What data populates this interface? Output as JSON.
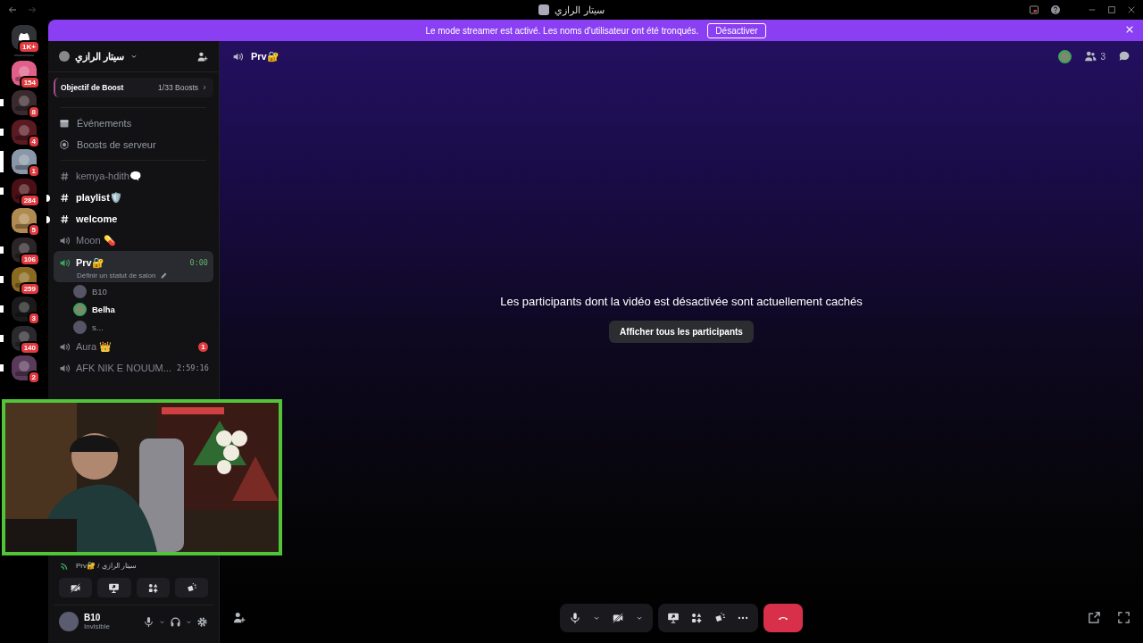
{
  "titlebar": {
    "title": "سيتار الرازي"
  },
  "banner": {
    "message": "Le mode streamer est activé. Les noms d'utilisateur ont été tronqués.",
    "button": "Désactiver"
  },
  "servers": [
    {
      "kind": "home",
      "badge": "1K+",
      "color": "#313338",
      "selected": false,
      "unread": false
    },
    {
      "kind": "server",
      "badge": "154",
      "color": "#e0608a",
      "selected": false,
      "unread": false
    },
    {
      "kind": "server",
      "badge": "8",
      "color": "#3a2a2e",
      "selected": false,
      "unread": true
    },
    {
      "kind": "server",
      "badge": "4",
      "color": "#5a1a22",
      "selected": false,
      "unread": true
    },
    {
      "kind": "server",
      "badge": "1",
      "color": "#8a97a8",
      "selected": true,
      "unread": false
    },
    {
      "kind": "server",
      "badge": "284",
      "color": "#4a1015",
      "selected": false,
      "unread": true
    },
    {
      "kind": "server",
      "badge": "5",
      "color": "#b08a50",
      "selected": false,
      "unread": false
    },
    {
      "kind": "server",
      "badge": "106",
      "color": "#2c2528",
      "selected": false,
      "unread": true
    },
    {
      "kind": "server",
      "badge": "259",
      "color": "#8a6a20",
      "selected": false,
      "unread": true
    },
    {
      "kind": "server",
      "badge": "3",
      "color": "#1a1a1a",
      "selected": false,
      "unread": true
    },
    {
      "kind": "server",
      "badge": "140",
      "color": "#2a2a2e",
      "selected": false,
      "unread": true
    },
    {
      "kind": "server",
      "badge": "2",
      "color": "#5a3a5a",
      "selected": false,
      "unread": true
    }
  ],
  "server_header": {
    "name": "سيتار الرازي"
  },
  "boost_goal": {
    "label": "Objectif de Boost",
    "progress": "1/33 Boosts"
  },
  "menu_items": [
    {
      "kind": "events",
      "label": "Événements"
    },
    {
      "kind": "boosts",
      "label": "Boosts de serveur"
    }
  ],
  "channels": [
    {
      "kind": "text",
      "name": "kemya-hdith🗨️",
      "unread": false,
      "selected": false
    },
    {
      "kind": "text",
      "name": "playlist🛡️",
      "unread": true,
      "selected": false
    },
    {
      "kind": "text",
      "name": "welcome",
      "unread": true,
      "selected": false
    },
    {
      "kind": "voice",
      "name": "Moon 💊",
      "unread": false,
      "selected": false
    },
    {
      "kind": "voice",
      "name": "Prv🔐",
      "unread": false,
      "selected": true,
      "timer": "0:00",
      "status": "Définir un statut de salon",
      "members": [
        {
          "name": "B10",
          "speaking": false
        },
        {
          "name": "Belha",
          "speaking": true
        },
        {
          "name": "s...",
          "speaking": false
        }
      ]
    },
    {
      "kind": "voice",
      "name": "Aura 👑",
      "unread": false,
      "selected": false,
      "mentions": "1"
    },
    {
      "kind": "voice",
      "name": "AFK NIK E NOUUM...",
      "unread": false,
      "selected": false,
      "timer": "2:59:16"
    }
  ],
  "voice_panel": {
    "location": "Prv🔐 / سيتار الرازي"
  },
  "user_panel": {
    "name": "B10",
    "status": "Invisible"
  },
  "main": {
    "channel": "Prv🔐",
    "member_count": "3",
    "notice": "Les participants dont la vidéo est désactivée sont actuellement cachés",
    "show_all_button": "Afficher tous les participants"
  }
}
